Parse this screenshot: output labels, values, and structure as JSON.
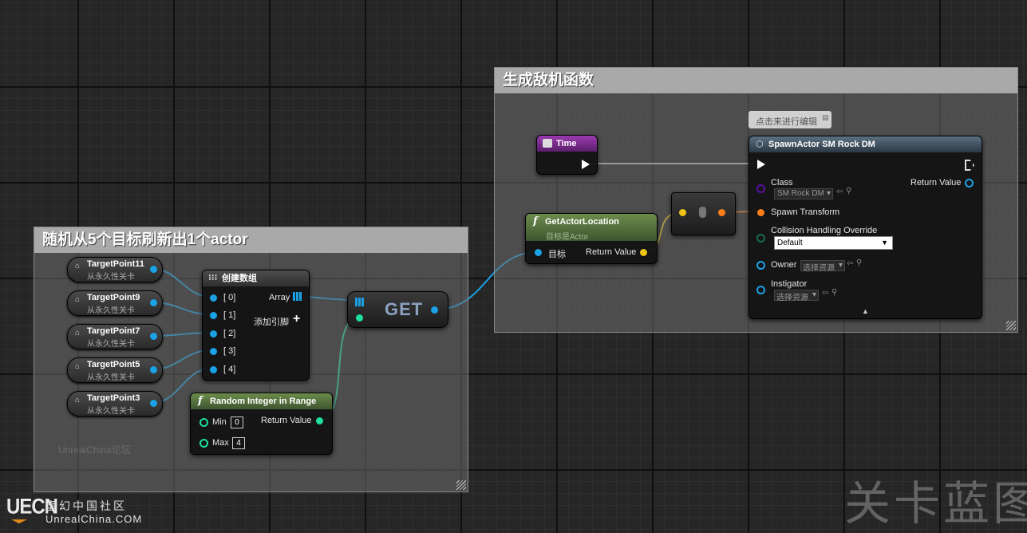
{
  "comments": {
    "left_title": "随机从5个目标刷新出1个actor",
    "right_title": "生成敌机函数"
  },
  "target_points": [
    {
      "name": "TargetPoint11",
      "sub": "从永久性关卡"
    },
    {
      "name": "TargetPoint9",
      "sub": "从永久性关卡"
    },
    {
      "name": "TargetPoint7",
      "sub": "从永久性关卡"
    },
    {
      "name": "TargetPoint5",
      "sub": "从永久性关卡"
    },
    {
      "name": "TargetPoint3",
      "sub": "从永久性关卡"
    }
  ],
  "make_array": {
    "title": "创建数组",
    "inputs": [
      "[ 0]",
      "[ 1]",
      "[ 2]",
      "[ 3]",
      "[ 4]"
    ],
    "output": "Array",
    "add_pin": "添加引脚"
  },
  "random_int": {
    "title": "Random Integer in Range",
    "min_label": "Min",
    "min_value": "0",
    "max_label": "Max",
    "max_value": "4",
    "output": "Return Value"
  },
  "get_node": {
    "label": "GET"
  },
  "time_node": {
    "title": "Time"
  },
  "get_actor_location": {
    "title": "GetActorLocation",
    "subtitle": "目标是Actor",
    "input": "目标",
    "output": "Return Value"
  },
  "spawn_actor": {
    "title": "SpawnActor SM Rock DM",
    "tooltip": "点击来进行编辑",
    "class_label": "Class",
    "class_value": "SM Rock DM",
    "return_label": "Return Value",
    "spawn_transform": "Spawn Transform",
    "collision_label": "Collision Handling Override",
    "collision_value": "Default",
    "owner_label": "Owner",
    "owner_value": "选择资源",
    "instigator_label": "Instigator",
    "instigator_value": "选择资源"
  },
  "watermarks": {
    "faded": "UnrealChina论坛",
    "logo": "UECN",
    "site_cn": "虚幻中国社区",
    "site_url": "UnrealChina.COM",
    "corner": "关卡蓝图"
  },
  "colors": {
    "object_pin": "#1aa1e6",
    "int_pin": "#1de0a0",
    "vector_pin": "#f0c419",
    "transform_pin": "#ff7e1a",
    "class_pin": "#5b0fa0",
    "pure_func_header": "#5b7a40",
    "time_header": "#7a2b8c",
    "spawn_header": "#3d4f5e"
  }
}
